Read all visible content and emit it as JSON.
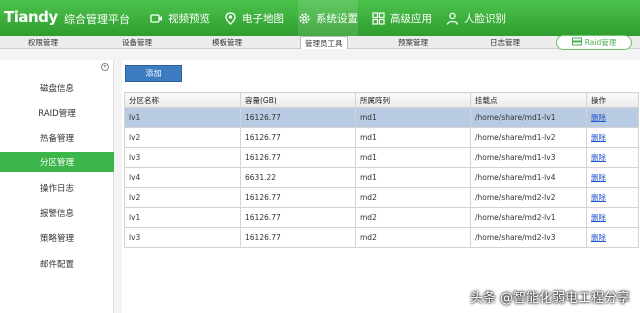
{
  "header": {
    "logo": "Tiandy",
    "brand": "综合管理平台",
    "nav": [
      {
        "label": "视频预览",
        "icon": "video-icon"
      },
      {
        "label": "电子地图",
        "icon": "map-icon"
      },
      {
        "label": "系统设置",
        "icon": "gear-icon"
      },
      {
        "label": "高级应用",
        "icon": "grid-icon"
      },
      {
        "label": "人脸识别",
        "icon": "face-icon"
      }
    ]
  },
  "subtabs": [
    "权限管理",
    "设备管理",
    "模板管理",
    "管理员工具",
    "预案管理",
    "日志管理"
  ],
  "raid_button": "Raid管理",
  "sidebar": {
    "items": [
      "磁盘信息",
      "RAID管理",
      "热备管理",
      "分区管理",
      "操作日志",
      "报警信息",
      "策略管理",
      "邮件配置"
    ],
    "active_index": 3
  },
  "toolbar": {
    "add_label": "添加"
  },
  "table": {
    "headers": [
      "分区名称",
      "容量(GB)",
      "所属阵列",
      "挂载点",
      "操作"
    ],
    "rows": [
      {
        "name": "lv1",
        "capacity": "16126.77",
        "array": "md1",
        "mount": "/home/share/md1-lv1",
        "op": "删除"
      },
      {
        "name": "lv2",
        "capacity": "16126.77",
        "array": "md1",
        "mount": "/home/share/md1-lv2",
        "op": "删除"
      },
      {
        "name": "lv3",
        "capacity": "16126.77",
        "array": "md1",
        "mount": "/home/share/md1-lv3",
        "op": "删除"
      },
      {
        "name": "lv4",
        "capacity": "6631.22",
        "array": "md1",
        "mount": "/home/share/md1-lv4",
        "op": "删除"
      },
      {
        "name": "lv2",
        "capacity": "16126.77",
        "array": "md2",
        "mount": "/home/share/md2-lv2",
        "op": "删除"
      },
      {
        "name": "lv1",
        "capacity": "16126.77",
        "array": "md2",
        "mount": "/home/share/md2-lv1",
        "op": "删除"
      },
      {
        "name": "lv3",
        "capacity": "16126.77",
        "array": "md2",
        "mount": "/home/share/md2-lv3",
        "op": "删除"
      }
    ],
    "selected_index": 0
  },
  "watermark": "头条 @智能化弱电工程分享",
  "colors": {
    "header_green": "#3aae3a",
    "active_green": "#3cb54a",
    "button_blue": "#3d7cc0",
    "selected_row": "#b8cbe2"
  }
}
